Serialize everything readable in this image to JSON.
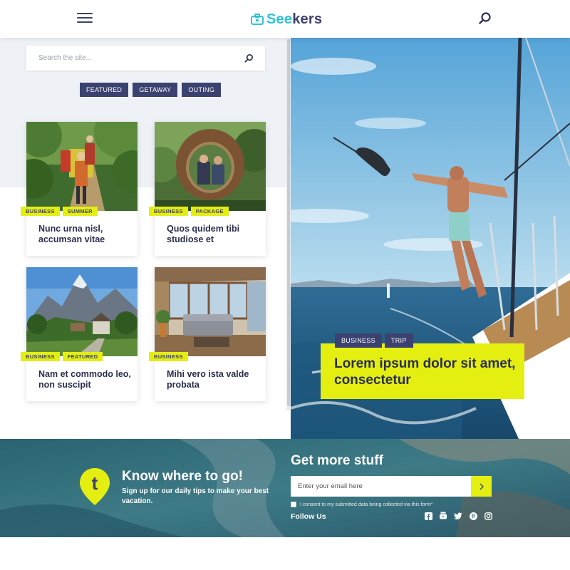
{
  "header": {
    "logo_text_accent": "See",
    "logo_text_rest": "kers"
  },
  "search": {
    "placeholder": "Search the site..."
  },
  "filters": [
    "FEATURED",
    "GETAWAY",
    "OUTING"
  ],
  "cards": [
    {
      "tags": [
        "BUSINESS",
        "SUMMER"
      ],
      "title": "Nunc urna nisl, accumsan vitae"
    },
    {
      "tags": [
        "BUSINESS",
        "PACKAGE"
      ],
      "title": "Quos quidem tibi studiose et"
    },
    {
      "tags": [
        "BUSINESS",
        "FEATURED"
      ],
      "title": "Nam et commodo leo, non suscipit"
    },
    {
      "tags": [
        "BUSINESS"
      ],
      "title": "Mihi vero ista valde probata"
    }
  ],
  "hero": {
    "tags": [
      "BUSINESS",
      "TRIP"
    ],
    "title": "Lorem ipsum dolor sit amet, consectetur"
  },
  "newsletter": {
    "pin_letter": "t",
    "know_title": "Know where to go!",
    "know_sub": "Sign up for our daily tips to make your best vacation.",
    "get_title": "Get more stuff",
    "email_placeholder": "Enter your email here",
    "consent": "I consent to my submitted data being collected via this form*",
    "follow": "Follow Us",
    "socials": [
      "facebook-icon",
      "youtube-icon",
      "twitter-icon",
      "pinterest-icon",
      "instagram-icon"
    ]
  },
  "colors": {
    "navy": "#3b4270",
    "lime": "#e5ee11",
    "teal": "#2ec4d6"
  }
}
